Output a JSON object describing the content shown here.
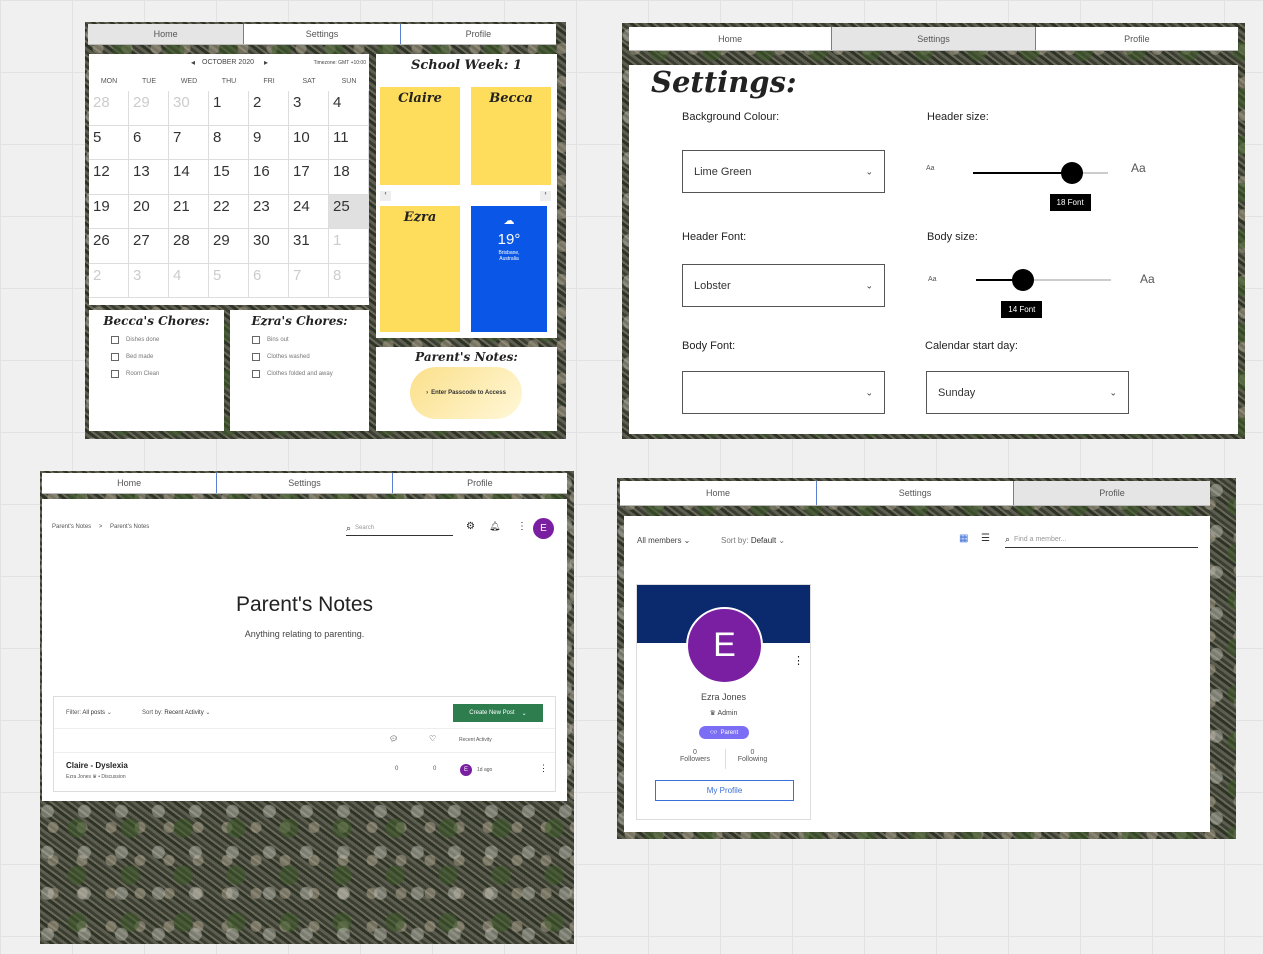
{
  "nav": {
    "home": "Home",
    "settings": "Settings",
    "profile": "Profile"
  },
  "calendar": {
    "month_label": "OCTOBER 2020",
    "prev": "◂",
    "next": "▸",
    "timezone": "Timezone: GMT +10:00",
    "weekdays": [
      "MON",
      "TUE",
      "WED",
      "THU",
      "FRI",
      "SAT",
      "SUN"
    ],
    "days": [
      "28",
      "29",
      "30",
      "1",
      "2",
      "3",
      "4",
      "5",
      "6",
      "7",
      "8",
      "9",
      "10",
      "11",
      "12",
      "13",
      "14",
      "15",
      "16",
      "17",
      "18",
      "19",
      "20",
      "21",
      "22",
      "23",
      "24",
      "25",
      "26",
      "27",
      "28",
      "29",
      "30",
      "31",
      "1",
      "2",
      "3",
      "4",
      "5",
      "6",
      "7",
      "8"
    ],
    "today": "25"
  },
  "school_week": {
    "title": "School Week: 1"
  },
  "stickies": {
    "claire": "Claire",
    "becca": "Becca",
    "ezra": "Ezra"
  },
  "weather": {
    "temp": "19°",
    "city": "Brisbane,",
    "country": "Australia"
  },
  "becca_chores": {
    "title": "Becca's Chores:",
    "items": [
      "Dishes done",
      "Bed made",
      "Room Clean"
    ]
  },
  "ezra_chores": {
    "title": "Ezra's Chores:",
    "items": [
      "Bins out",
      "Clothes washed",
      "Clothes folded and away"
    ]
  },
  "parents_notes_card": {
    "title": "Parent's Notes:",
    "button": "Enter Passcode to Access"
  },
  "settings": {
    "title": "Settings:",
    "bg_label": "Background Colour:",
    "bg_value": "Lime Green",
    "header_size_label": "Header size:",
    "header_size_value": "18 Font",
    "header_size_level": 0.73,
    "header_font_label": "Header Font:",
    "header_font_value": "Lobster",
    "body_size_label": "Body size:",
    "body_size_value": "14 Font",
    "body_size_level": 0.35,
    "body_font_label": "Body Font:",
    "body_font_value": "",
    "cal_start_label": "Calendar start day:",
    "cal_start_value": "Sunday",
    "aa_small": "Aa",
    "aa_large": "Aa"
  },
  "forum": {
    "breadcrumb_1": "Parent's Notes",
    "breadcrumb_sep": ">",
    "breadcrumb_2": "Parent's Notes",
    "search_placeholder": "Search",
    "avatar": "E",
    "title": "Parent's Notes",
    "subtitle": "Anything relating to parenting.",
    "filter_label": "Filter:",
    "filter_value": "All posts",
    "sort_label": "Sort by:",
    "sort_value": "Recent Activity",
    "create_button": "Create New Post",
    "col_recent": "Recent Activity",
    "post": {
      "title": "Claire - Dyslexia",
      "author": "Ezra Jones",
      "category": "Discussion",
      "comments": "0",
      "likes": "0",
      "avatar": "E",
      "time": "1d ago"
    }
  },
  "members": {
    "filter": "All members",
    "sort_label": "Sort by:",
    "sort_value": "Default",
    "search_placeholder": "Find a member...",
    "avatar_letter": "E",
    "name": "Ezra Jones",
    "role": "Admin",
    "badge": "Parent",
    "followers_count": "0",
    "followers_label": "Followers",
    "following_count": "0",
    "following_label": "Following",
    "profile_button": "My Profile"
  },
  "colors": {
    "sticky": "#ffdd5c",
    "weather": "#0a56e6",
    "avatar": "#7b1fa2",
    "banner": "#0b2a6e",
    "create_button": "#2e7d4f",
    "badge": "#7c6df5"
  }
}
